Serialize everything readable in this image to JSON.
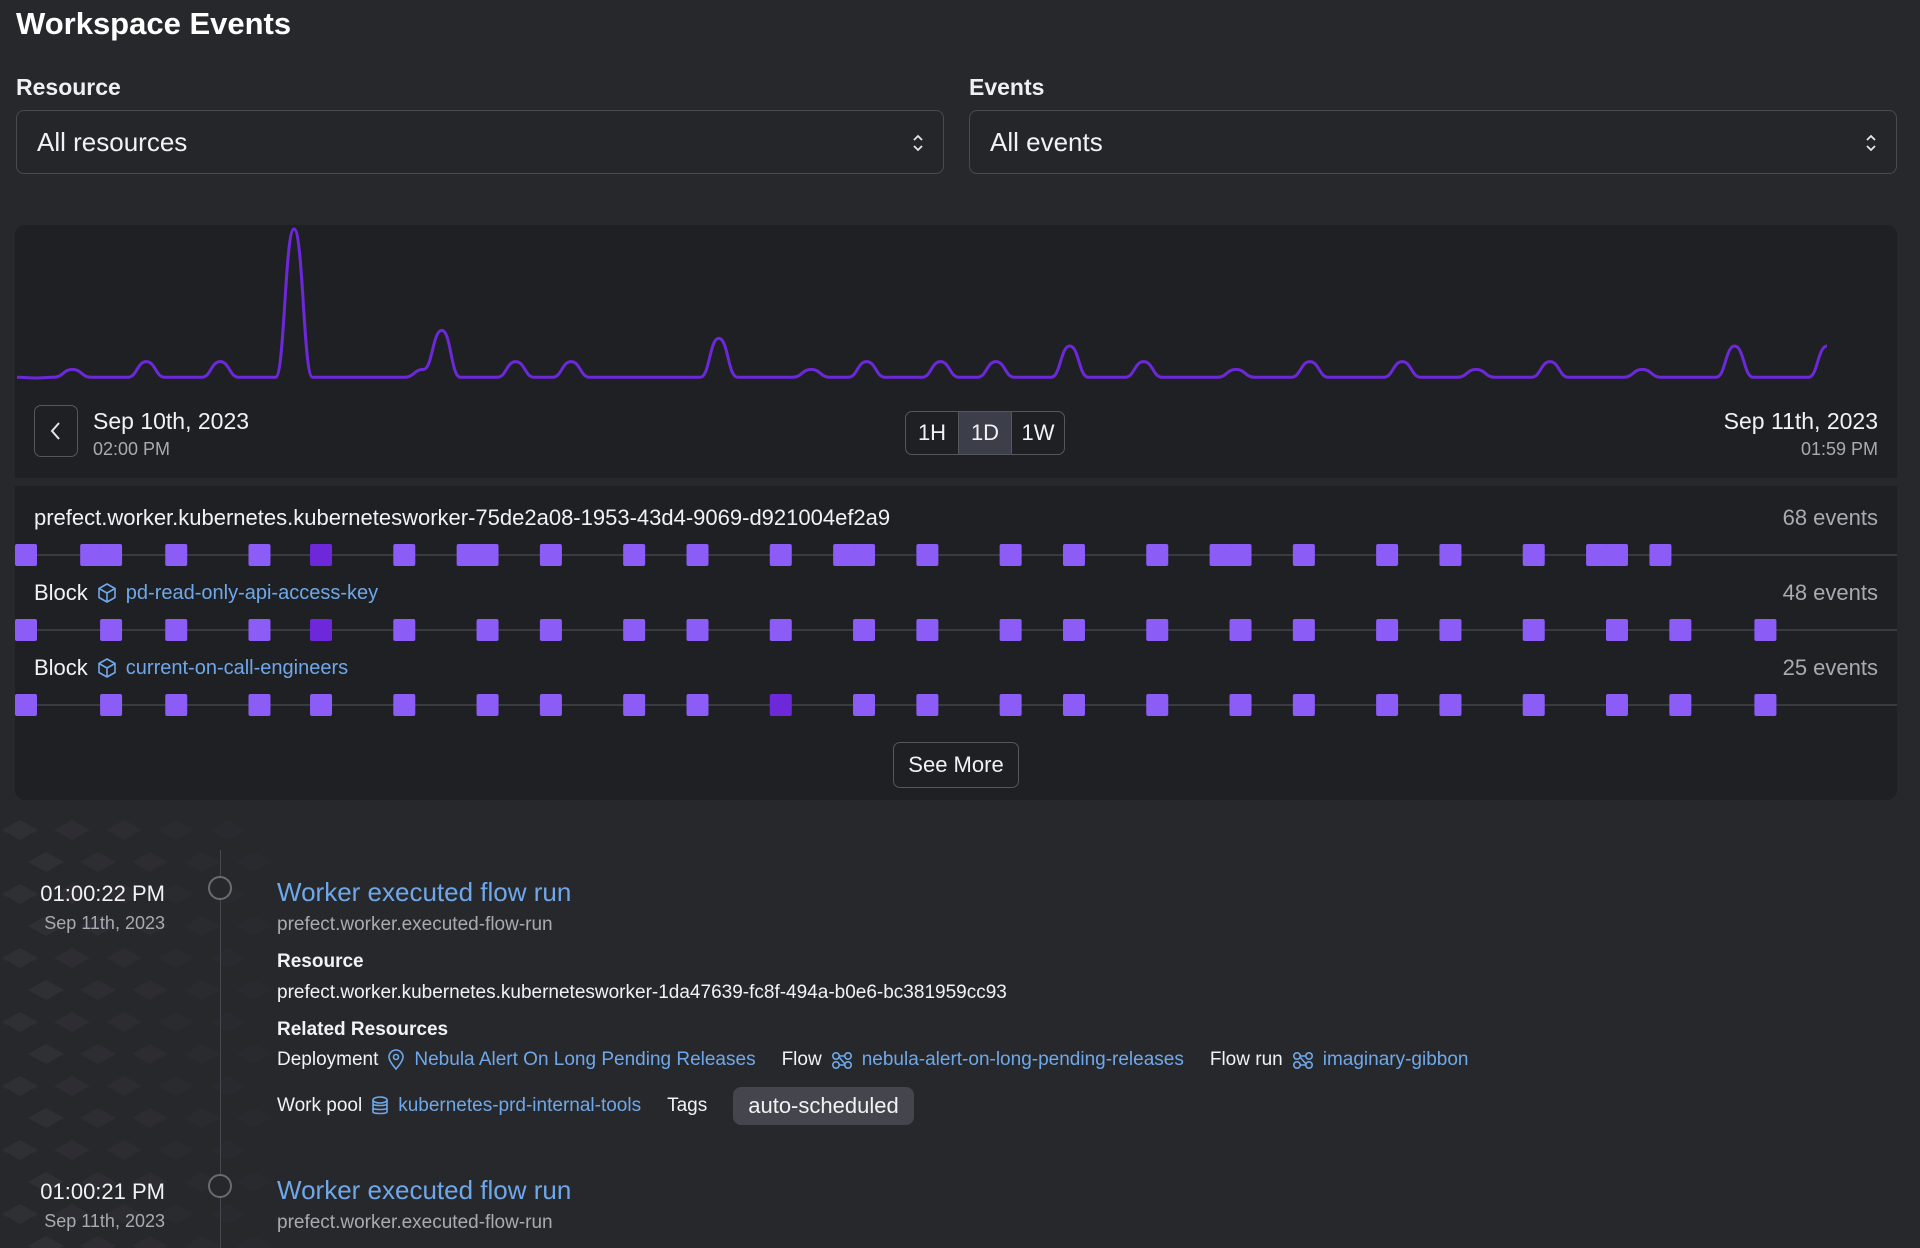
{
  "page": {
    "title": "Workspace Events"
  },
  "filters": {
    "resource": {
      "label": "Resource",
      "value": "All resources"
    },
    "events": {
      "label": "Events",
      "value": "All events"
    }
  },
  "chart": {
    "start_date": "Sep 10th, 2023",
    "start_time": "02:00 PM",
    "end_date": "Sep 11th, 2023",
    "end_time": "01:59 PM",
    "ranges": [
      "1H",
      "1D",
      "1W"
    ],
    "active_range": "1D",
    "line_color": "#6d28d9"
  },
  "chart_data": {
    "type": "line",
    "title": "",
    "xlabel": "",
    "ylabel": "",
    "x_range": [
      "Sep 10th, 2023 02:00 PM",
      "Sep 11th, 2023 01:59 PM"
    ],
    "series": [
      {
        "values": [
          1,
          0.9,
          1,
          2,
          1,
          1,
          1,
          3,
          1,
          1,
          1,
          3,
          1,
          1,
          1,
          20,
          1,
          1,
          1,
          1,
          1,
          1,
          2,
          7,
          1,
          1,
          1,
          3,
          1,
          1,
          3,
          1,
          1,
          1,
          1,
          1,
          1,
          1,
          6,
          1,
          1,
          1,
          1,
          2,
          1,
          1,
          3,
          1,
          1,
          1,
          3,
          1,
          1,
          3,
          1,
          1,
          1,
          5,
          1,
          1,
          1,
          3,
          1,
          1,
          1,
          1,
          2,
          1,
          1,
          1,
          3,
          1,
          1,
          1,
          1,
          3,
          1,
          1,
          1,
          2,
          1,
          1,
          1,
          3,
          1,
          1,
          1,
          1,
          2,
          1,
          1,
          1,
          1,
          5,
          1,
          1,
          1,
          1,
          5
        ]
      }
    ]
  },
  "resources": [
    {
      "kind": "",
      "name": "prefect.worker.kubernetes.kubernetesworker-75de2a08-1953-43d4-9069-d921004ef2a9",
      "count_label": "68 events",
      "markers": [
        0.0,
        0.036,
        0.047,
        0.083,
        0.129,
        0.163,
        0.209,
        0.244,
        0.255,
        0.29,
        0.336,
        0.371,
        0.417,
        0.452,
        0.463,
        0.498,
        0.544,
        0.579,
        0.625,
        0.66,
        0.671,
        0.706,
        0.752,
        0.787,
        0.833,
        0.868,
        0.879,
        0.903
      ],
      "highlight": [
        0.163
      ]
    },
    {
      "kind": "Block",
      "name": "pd-read-only-api-access-key",
      "count_label": "48 events",
      "markers": [
        0.0,
        0.047,
        0.083,
        0.129,
        0.163,
        0.209,
        0.255,
        0.29,
        0.336,
        0.371,
        0.417,
        0.463,
        0.498,
        0.544,
        0.579,
        0.625,
        0.671,
        0.706,
        0.752,
        0.787,
        0.833,
        0.879,
        0.914,
        0.961
      ],
      "highlight": [
        0.163
      ]
    },
    {
      "kind": "Block",
      "name": "current-on-call-engineers",
      "count_label": "25 events",
      "markers": [
        0.0,
        0.047,
        0.083,
        0.129,
        0.163,
        0.209,
        0.255,
        0.29,
        0.336,
        0.371,
        0.417,
        0.463,
        0.498,
        0.544,
        0.579,
        0.625,
        0.671,
        0.706,
        0.752,
        0.787,
        0.833,
        0.879,
        0.914,
        0.961
      ],
      "highlight": [
        0.417
      ]
    }
  ],
  "see_more_label": "See More",
  "events": [
    {
      "time": "01:00:22 PM",
      "date": "Sep 11th, 2023",
      "title": "Worker executed flow run",
      "event_name": "prefect.worker.executed-flow-run",
      "resource_heading": "Resource",
      "resource_value": "prefect.worker.kubernetes.kubernetesworker-1da47639-fc8f-494a-b0e6-bc381959cc93",
      "related_heading": "Related Resources",
      "deployment_label": "Deployment",
      "deployment_value": "Nebula Alert On Long Pending Releases",
      "flow_label": "Flow",
      "flow_value": "nebula-alert-on-long-pending-releases",
      "flowrun_label": "Flow run",
      "flowrun_value": "imaginary-gibbon",
      "workpool_label": "Work pool",
      "workpool_value": "kubernetes-prd-internal-tools",
      "tags_label": "Tags",
      "tag": "auto-scheduled"
    },
    {
      "time": "01:00:21 PM",
      "date": "Sep 11th, 2023",
      "title": "Worker executed flow run",
      "event_name": "prefect.worker.executed-flow-run"
    }
  ]
}
